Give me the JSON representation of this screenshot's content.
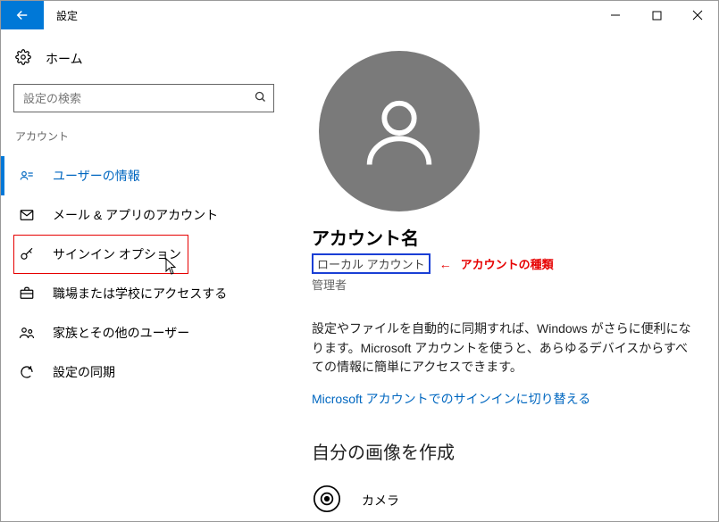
{
  "titlebar": {
    "title": "設定"
  },
  "sidebar": {
    "home_label": "ホーム",
    "search_placeholder": "設定の検索",
    "section_label": "アカウント",
    "items": [
      {
        "label": "ユーザーの情報"
      },
      {
        "label": "メール & アプリのアカウント"
      },
      {
        "label": "サインイン オプション"
      },
      {
        "label": "職場または学校にアクセスする"
      },
      {
        "label": "家族とその他のユーザー"
      },
      {
        "label": "設定の同期"
      }
    ]
  },
  "content": {
    "account_name": "アカウント名",
    "account_type": "ローカル アカウント",
    "annotation": "アカウントの種類",
    "account_role": "管理者",
    "paragraph": "設定やファイルを自動的に同期すれば、Windows がさらに便利になります。Microsoft アカウントを使うと、あらゆるデバイスからすべての情報に簡単にアクセスできます。",
    "link": "Microsoft アカウントでのサインインに切り替える",
    "picture_heading": "自分の画像を作成",
    "camera_label": "カメラ"
  }
}
